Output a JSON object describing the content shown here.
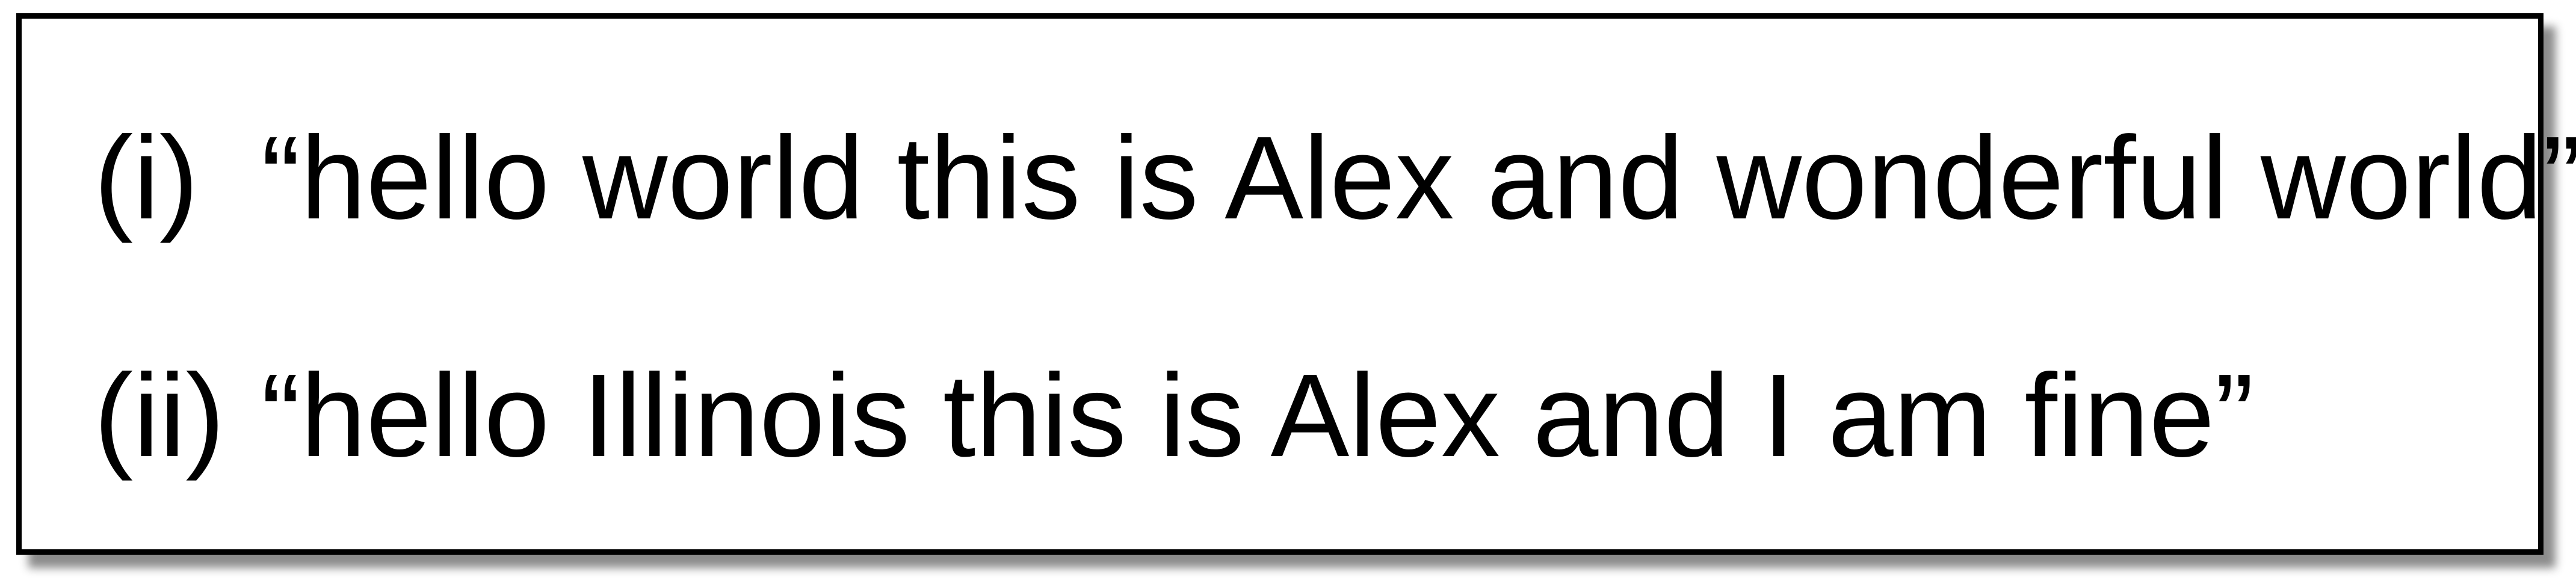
{
  "items": [
    {
      "marker": "(i)",
      "quote": "“hello world this is Alex and wonderful world”"
    },
    {
      "marker": "(ii)",
      "quote": "“hello Illinois this is Alex and I am fine”"
    }
  ]
}
